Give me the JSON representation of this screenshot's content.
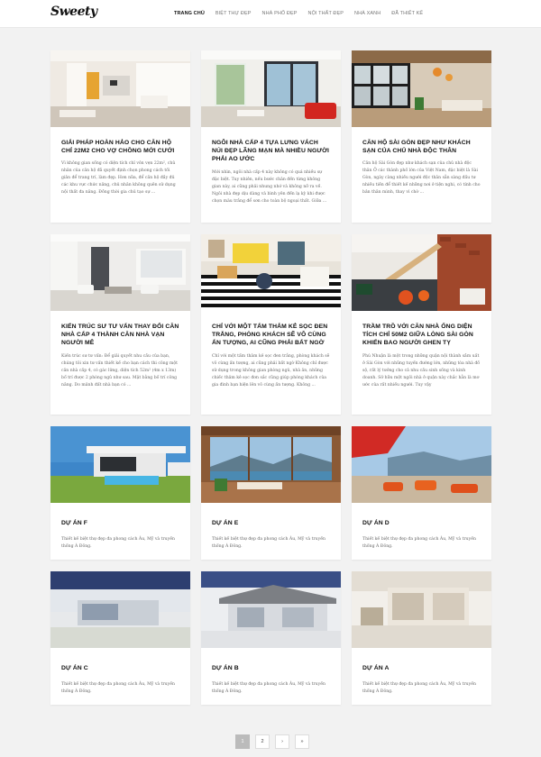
{
  "header": {
    "logo": "Sweety",
    "nav": [
      {
        "label": "TRANG CHỦ",
        "active": true
      },
      {
        "label": "BIỆT THỰ ĐẸP",
        "active": false
      },
      {
        "label": "NHÀ PHỐ ĐẸP",
        "active": false
      },
      {
        "label": "NỘI THẤT ĐẸP",
        "active": false
      },
      {
        "label": "NHÀ XANH",
        "active": false
      },
      {
        "label": "ĐÃ THIẾT KẾ",
        "active": false
      }
    ]
  },
  "posts": [
    {
      "title": "Giải pháp hoàn hảo cho căn hộ chỉ 22m2 cho vợ chồng mới cưới",
      "excerpt": "Vì không gian sống có diện tích chỉ vỏn vẹn 22m², chủ nhân của căn hộ đã quyết định chọn phong cách tối giản để trang trí, làm đẹp. Hơn nữa, để căn hộ đầy đủ các khu vực chức năng, chủ nhân không quên sử dụng nội thất đa năng. Đồng thời gia chủ tạo sự ..."
    },
    {
      "title": "Ngôi nhà cấp 4 tựa lưng vách núi đẹp lãng mạn mà nhiều người phải ao ước",
      "excerpt": "Mới nhìn, ngôi nhà cấp 4 này không có quá nhiều sự đặc biệt. Tuy nhiên, nếu bước chân đến từng không gian này, ai cũng phải nhung nhớ và không nỡ ra về. Ngôi nhà đẹp dịu dàng và bình yên đến lạ kỳ khi được chọn màu trắng để sơn cho toàn bộ ngoại thất. Giữa ..."
    },
    {
      "title": "Căn hộ Sài Gòn đẹp như khách sạn của chủ nhà độc thân",
      "excerpt": "Căn hộ Sài Gòn đẹp như khách sạn của chủ nhà độc thân Ở các thành phố lớn của Việt Nam, đặc biệt là Sài Gòn, ngày càng nhiều người độc thân sẵn sàng đầu tư nhiều tiền để thiết kế những nơi ở tiện nghi, có tính cho bản thân mình, thay vì chờ ..."
    },
    {
      "title": "Kiến trúc sư tư vấn thay đổi căn nhà cấp 4 thành căn nhà vạn người mê",
      "excerpt": "Kiến trúc sư tư vấn: Để giải quyết nhu cầu của bạn, chúng tôi xin tư vấn thiết kế cho bạn cách thi công một căn nhà cấp 4, có gác lửng, diện tích 52m² (4m x 13m) bố trí được 2 phòng ngủ như sau. Mặt bằng bố trí công năng. Do mảnh đất nhà bạn có ..."
    },
    {
      "title": "Chỉ với một tấm thảm kẻ sọc đen trắng, phòng khách sẽ vô cùng ấn tượng, ai cũng phải bất ngờ",
      "excerpt": "Chỉ với một tấm thảm kẻ sọc đen trắng, phòng khách sẽ vô cùng ấn tượng, ai cũng phải bất ngờ Không chỉ được sử dụng trong không gian phòng ngủ, nhà ăn, những chiếc thảm kẻ sọc đơn sắc cũng giúp phòng khách của gia đình bạn hiện lên vô cùng ấn tượng. Không ..."
    },
    {
      "title": "Trầm trồ với căn nhà ống diện tích chỉ 50m2 giữa lòng Sài Gòn khiến bao người ghen tỵ",
      "excerpt": "Phú Nhuận là một trong những quận nội thành sầm uất ở Sài Gòn với những tuyến đường lớn, những tòa nhà đồ sộ, rất lý tưởng cho cả nhu cầu sinh sống và kinh doanh. Sở hữu một ngôi nhà ở quận này chắc hẳn là mơ ước của rất nhiều người. Tuy vậy"
    },
    {
      "title": "Dự án F",
      "excerpt": "Thiết kế biệt thự đẹp đa phong cách Âu, Mỹ và truyền thống Á Đông."
    },
    {
      "title": "Dự án E",
      "excerpt": "Thiết kế biệt thự đẹp đa phong cách Âu, Mỹ và truyền thống Á Đông."
    },
    {
      "title": "Dự án D",
      "excerpt": "Thiết kế biệt thự đẹp đa phong cách Âu, Mỹ và truyền thống Á Đông."
    },
    {
      "title": "Dự án C",
      "excerpt": "Thiết kế biệt thự đẹp đa phong cách Âu, Mỹ và truyền thống Á Đông."
    },
    {
      "title": "Dự án B",
      "excerpt": "Thiết kế biệt thự đẹp đa phong cách Âu, Mỹ và truyền thống Á Đông."
    },
    {
      "title": "Dự án A",
      "excerpt": "Thiết kế biệt thự đẹp đa phong cách Âu, Mỹ và truyền thống Á Đông."
    }
  ],
  "pagination": {
    "pages": [
      "1",
      "2"
    ],
    "current": "1",
    "next": "›",
    "last": "»"
  }
}
